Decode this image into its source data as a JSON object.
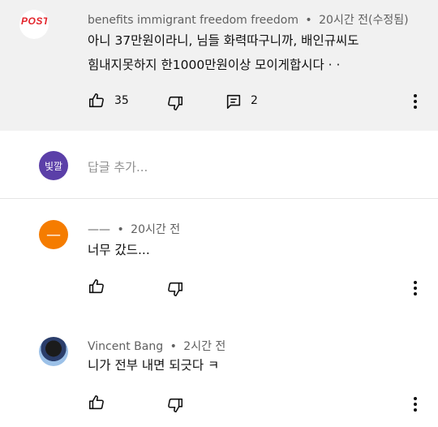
{
  "comments": [
    {
      "author": "benefits immigrant freedom freedom",
      "time": "20시간 전(수정됨)",
      "line1": "아니 37만원이라니,  님들 화력따구니까, 배인규씨도",
      "line2": "힘내지못하지 한1000만원이상 모이게합시다 · ·",
      "likes": "35",
      "replies": "2",
      "avatar_text": "POST"
    },
    {
      "author": "——",
      "time": "20시간 전",
      "line1": "너무 갔드...",
      "avatar_text": "—"
    },
    {
      "author": "Vincent Bang",
      "time": "2시간 전",
      "line1": "니가 전부 내면 되긋다 ㅋ"
    }
  ],
  "reply_box": {
    "avatar_text": "빛깔",
    "placeholder": "답글 추가..."
  },
  "separator": "•",
  "colors": {
    "highlight_bg": "#f1f1f1",
    "meta_text": "#606060",
    "avatar_purple": "#5b3fa8",
    "avatar_orange": "#f57c00",
    "post_red": "#e3242b"
  }
}
